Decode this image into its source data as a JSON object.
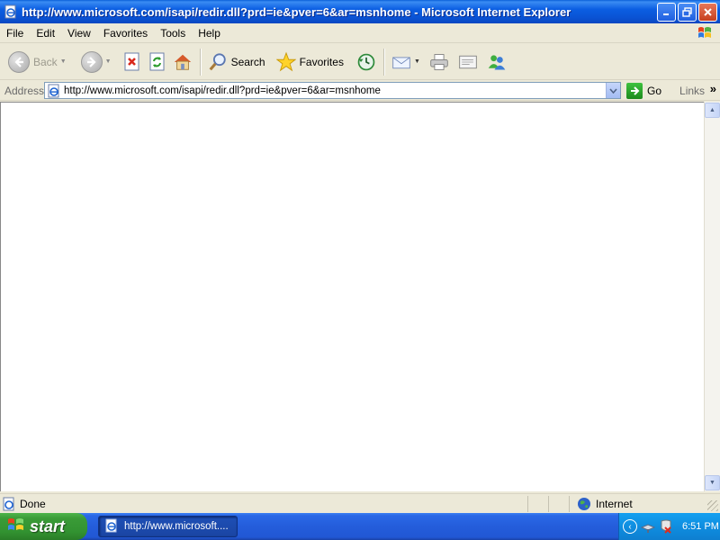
{
  "window": {
    "title": "http://www.microsoft.com/isapi/redir.dll?prd=ie&pver=6&ar=msnhome - Microsoft Internet Explorer"
  },
  "menu": {
    "items": [
      "File",
      "Edit",
      "View",
      "Favorites",
      "Tools",
      "Help"
    ]
  },
  "toolbar": {
    "back_label": "Back",
    "search_label": "Search",
    "favorites_label": "Favorites"
  },
  "address": {
    "label": "Address",
    "url": "http://www.microsoft.com/isapi/redir.dll?prd=ie&pver=6&ar=msnhome",
    "go_label": "Go",
    "links_label": "Links"
  },
  "status": {
    "text": "Done",
    "zone": "Internet"
  },
  "taskbar": {
    "start_label": "start",
    "task_label": "http://www.microsoft....",
    "clock": "6:51 PM"
  },
  "colors": {
    "titlebar": "#0b5ee2",
    "start_button": "#3a9b37",
    "taskbar": "#245ddb",
    "tray": "#0f8ee0"
  }
}
